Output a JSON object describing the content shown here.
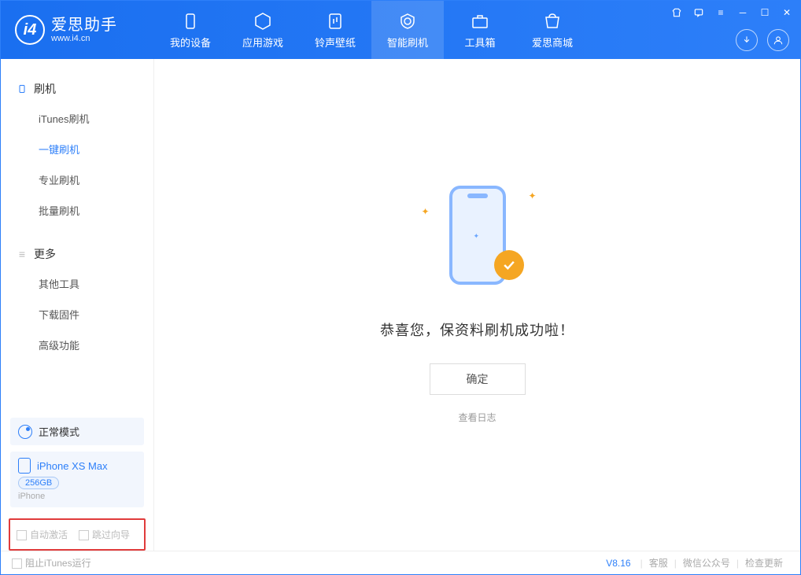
{
  "app": {
    "title": "爱思助手",
    "subtitle": "www.i4.cn"
  },
  "nav": {
    "tabs": [
      {
        "label": "我的设备"
      },
      {
        "label": "应用游戏"
      },
      {
        "label": "铃声壁纸"
      },
      {
        "label": "智能刷机"
      },
      {
        "label": "工具箱"
      },
      {
        "label": "爱思商城"
      }
    ]
  },
  "sidebar": {
    "group1_title": "刷机",
    "group1_items": [
      "iTunes刷机",
      "一键刷机",
      "专业刷机",
      "批量刷机"
    ],
    "group2_title": "更多",
    "group2_items": [
      "其他工具",
      "下载固件",
      "高级功能"
    ]
  },
  "device": {
    "mode": "正常模式",
    "name": "iPhone XS Max",
    "capacity": "256GB",
    "subtype": "iPhone"
  },
  "options": {
    "auto_activate": "自动激活",
    "skip_guide": "跳过向导"
  },
  "main": {
    "success_message": "恭喜您，保资料刷机成功啦！",
    "ok_button": "确定",
    "view_log": "查看日志"
  },
  "footer": {
    "block_itunes": "阻止iTunes运行",
    "version": "V8.16",
    "support": "客服",
    "wechat": "微信公众号",
    "update": "检查更新"
  }
}
